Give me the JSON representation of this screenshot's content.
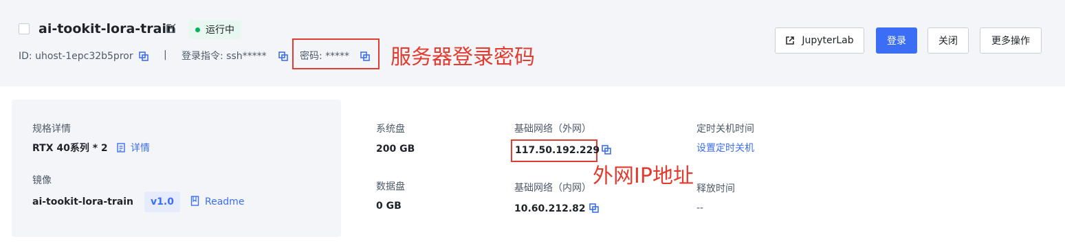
{
  "header": {
    "title": "ai-tookit-lora-train",
    "status": "运行中",
    "id_text": "ID: uhost-1epc32b5pror",
    "divider": "|",
    "login_cmd": "登录指令: ssh*****",
    "password": "密码: *****",
    "buttons": {
      "jupyter": "JupyterLab",
      "login": "登录",
      "close": "关闭",
      "more": "更多操作"
    }
  },
  "annotations": {
    "password_note": "服务器登录密码",
    "ip_note": "外网IP地址"
  },
  "details": {
    "spec_label": "规格详情",
    "spec_value": "RTX 40系列 * 2",
    "spec_link": "详情",
    "image_label": "镜像",
    "image_value": "ai-tookit-lora-train",
    "image_version": "v1.0",
    "readme_link": "Readme",
    "system_disk_label": "系统盘",
    "system_disk_value": "200 GB",
    "data_disk_label": "数据盘",
    "data_disk_value": "0 GB",
    "public_net_label": "基础网络（外网）",
    "public_ip": "117.50.192.229",
    "private_net_label": "基础网络（内网）",
    "private_ip": "10.60.212.82",
    "shutdown_label": "定时关机时间",
    "shutdown_link": "设置定时关机",
    "release_label": "释放时间",
    "release_value": "--"
  },
  "colors": {
    "accent": "#3b6ef5",
    "annotation": "#e33b2e",
    "running": "#00b45a"
  }
}
